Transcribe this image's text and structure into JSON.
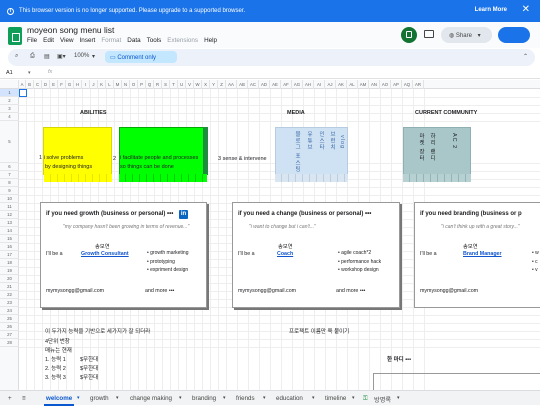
{
  "banner": {
    "text": "This browser version is no longer supported. Please upgrade to a supported browser.",
    "learn": "Learn More",
    "close": "✕"
  },
  "doc": {
    "title": "moyeon song menu list"
  },
  "menu": [
    "File",
    "Edit",
    "View",
    "Insert",
    "Format",
    "Data",
    "Tools",
    "Extensions",
    "Help"
  ],
  "share": "Share",
  "toolbar": {
    "zoom": "100%",
    "comment_only": "Comment only"
  },
  "namebox": "A1",
  "fx": "fx",
  "columns": [
    "A",
    "B",
    "C",
    "D",
    "E",
    "F",
    "G",
    "H",
    "I",
    "J",
    "K",
    "L",
    "M",
    "N",
    "O",
    "P",
    "Q",
    "R",
    "S",
    "T",
    "U",
    "V",
    "W",
    "X",
    "Y",
    "Z",
    "AA",
    "AB",
    "AC",
    "AD",
    "AE",
    "AF",
    "AG",
    "AH",
    "AI",
    "AJ",
    "AK",
    "AL",
    "AM",
    "AN",
    "AO",
    "AP",
    "AQ",
    "AR"
  ],
  "rows": [
    "1",
    "2",
    "3",
    "4",
    "5",
    "6",
    "7",
    "8",
    "9",
    "10",
    "11",
    "12",
    "13",
    "14",
    "15",
    "16",
    "17",
    "18",
    "19",
    "20",
    "21",
    "22",
    "23",
    "24",
    "25",
    "26",
    "27",
    "28"
  ],
  "headers": {
    "abilities": "ABILITIES",
    "media": "MEDIA",
    "community": "CURRENT COMMUNITY"
  },
  "abilities": {
    "item1": "1  i solve problems",
    "item1b": "by designing things",
    "n2": "2",
    "item2": "i facilitate people and processes",
    "item2b": "so things can be done",
    "item3": "3  sense & intervene"
  },
  "media_v": [
    "블로그 포스팅",
    "유튜브",
    "인스타",
    "브런치",
    "vlog"
  ],
  "community_v": [
    "마켓 장터",
    "하리 랜디",
    "AC 2"
  ],
  "cards": [
    {
      "title": "if you need growth (business or personal) •••",
      "quote": "\"my company hasn't been growing in terms of revenue...\"",
      "name": "송모연",
      "lead": "I'll be a",
      "role": "Growth Consultant",
      "bullets": [
        "• growth marketing",
        "• prototyping",
        "• expriment design"
      ],
      "email": "mymysongg@gmail.com",
      "more": "and more •••"
    },
    {
      "title": "if you need a change (business or personal) •••",
      "quote": "\"i want to change but i can't...\"",
      "name": "송모연",
      "lead": "I'll be a",
      "role": "Coach",
      "bullets": [
        "• agile coach*2",
        "• performance hack",
        "• workshop design"
      ],
      "email": "mymysongg@gmail.com",
      "more": "and more •••"
    },
    {
      "title": "if you need branding (business or p",
      "quote": "\"i can't think up with a great story...\"",
      "name": "송모연",
      "lead": "I'll be a",
      "role": "Brand Manager",
      "bullets": [
        "• w",
        "• c",
        "• v"
      ],
      "email": "mymysongg@gmail.com",
      "more": ""
    }
  ],
  "notes": {
    "line1": "이 두가지 능력을 기반으로 세가지가 잘 되더라",
    "line2": "4단위 번창",
    "line3": "매뉴는 현재",
    "l1": "1. 능력 1",
    "p1": "$무한대",
    "l2": "2. 능력 2",
    "p2": "$무한대",
    "l3": "3. 능력 3",
    "p3": "$무한대",
    "project": "프로젝트 이름만 쭉 붙이기",
    "oneword": "한 마디 •••"
  },
  "tabs": [
    "welcome",
    "growth",
    "change making",
    "branding",
    "friends",
    "education",
    "timeline",
    "방명록"
  ],
  "colors": {
    "yellow": "#ffff00",
    "green": "#00ff00",
    "dkgreen": "#1e8e3e",
    "media": "#cfe2f3",
    "community": "#a9c7c9",
    "blue": "#1a73e8"
  }
}
